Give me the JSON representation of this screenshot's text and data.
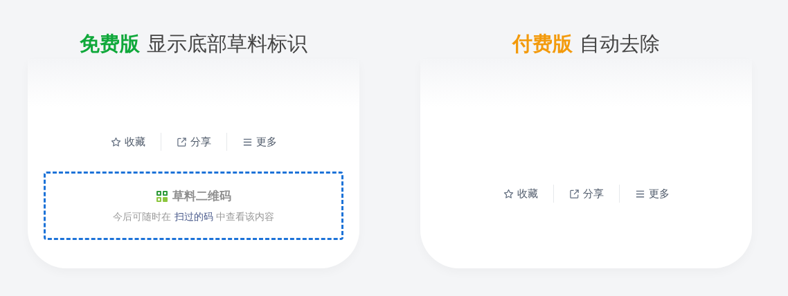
{
  "panels": [
    {
      "heading": {
        "highlight": "免费版",
        "color": "#0fa83a",
        "text": "显示底部草料标识"
      },
      "actions": [
        {
          "kind": "star",
          "label": "收藏"
        },
        {
          "kind": "share",
          "label": "分享"
        },
        {
          "kind": "menu",
          "label": "更多"
        }
      ],
      "watermark": {
        "title": "草料二维码",
        "hint_before": "今后可随时在",
        "link": "扫过的码",
        "hint_after": "中查看该内容"
      }
    },
    {
      "heading": {
        "highlight": "付费版",
        "color": "#f39a0b",
        "text": "自动去除"
      },
      "actions": [
        {
          "kind": "star",
          "label": "收藏"
        },
        {
          "kind": "share",
          "label": "分享"
        },
        {
          "kind": "menu",
          "label": "更多"
        }
      ]
    }
  ]
}
